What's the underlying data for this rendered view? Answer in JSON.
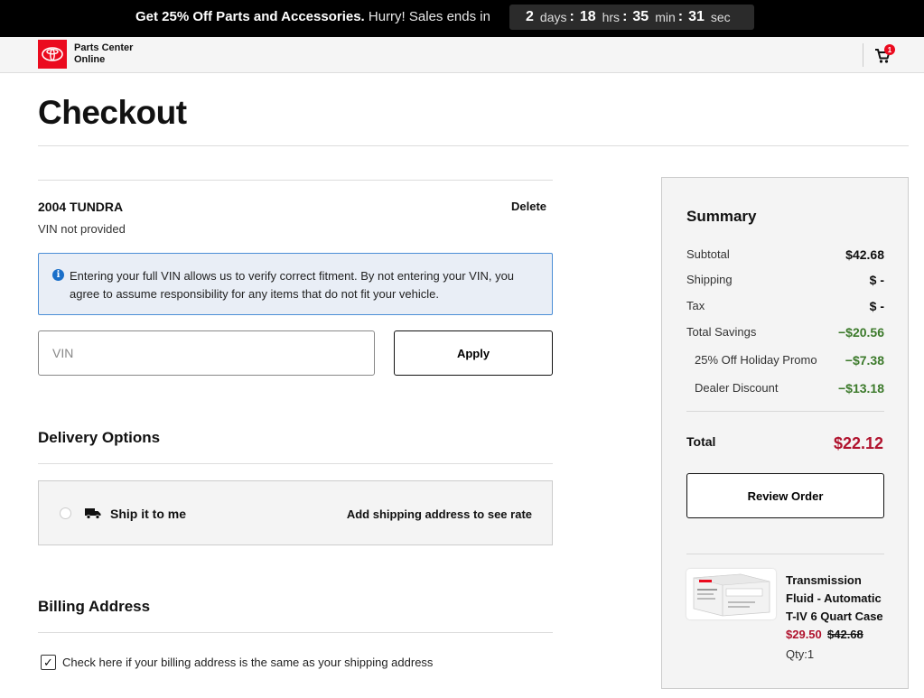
{
  "promo": {
    "headline": "Get 25% Off Parts and Accessories.",
    "hurry": "Hurry! Sales ends in",
    "countdown": {
      "days": "2",
      "days_unit": "days",
      "hours": "18",
      "hours_unit": "hrs",
      "minutes": "35",
      "minutes_unit": "min",
      "seconds": "31",
      "seconds_unit": "sec"
    }
  },
  "header": {
    "brand_line1": "Parts Center",
    "brand_line2": "Online",
    "cart_count": "1"
  },
  "page": {
    "title": "Checkout"
  },
  "vehicle": {
    "name": "2004 TUNDRA",
    "vin_status": "VIN not provided",
    "delete_label": "Delete",
    "info_text": "Entering your full VIN allows us to verify correct fitment. By not entering your VIN, you agree to assume responsibility for any items that do not fit your vehicle.",
    "vin_placeholder": "VIN",
    "apply_label": "Apply"
  },
  "delivery": {
    "title": "Delivery Options",
    "option_label": "Ship it to me",
    "rate_text": "Add shipping address to see rate"
  },
  "billing": {
    "title": "Billing Address",
    "same_as_shipping_label": "Check here if your billing address is the same as your shipping address",
    "same_as_shipping_checked": true
  },
  "summary": {
    "title": "Summary",
    "subtotal_label": "Subtotal",
    "subtotal": "$42.68",
    "shipping_label": "Shipping",
    "shipping": "$ -",
    "tax_label": "Tax",
    "tax": "$ -",
    "savings_label": "Total Savings",
    "savings": "−$20.56",
    "promo_label": "25% Off Holiday Promo",
    "promo_value": "−$7.38",
    "dealer_label": "Dealer Discount",
    "dealer_value": "−$13.18",
    "total_label": "Total",
    "total": "$22.12",
    "review_label": "Review Order"
  },
  "cart_item": {
    "name": "Transmission Fluid - Automatic T-IV 6 Quart Case",
    "price_sale": "$29.50",
    "price_original": "$42.68",
    "qty": "Qty:1",
    "image_label": "ATF Type T-IV"
  },
  "colors": {
    "brand_red": "#eb0a1e",
    "price_red": "#b0122d",
    "savings_green": "#3c7a2b",
    "info_blue": "#1a6fc9"
  }
}
